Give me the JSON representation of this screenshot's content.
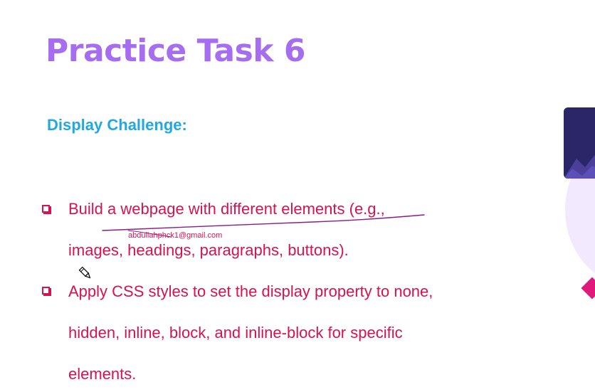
{
  "slide": {
    "title": "Practice Task 6",
    "subtitle": "Display Challenge:",
    "bullets": [
      {
        "lines": [
          "Build a webpage with different elements (e.g.,",
          "images, headings, paragraphs, buttons)."
        ]
      },
      {
        "lines": [
          "Apply CSS styles to set the display property to none,",
          "hidden, inline, block, and inline-block for specific",
          "elements."
        ]
      }
    ],
    "watermark": "abdullahphck1@gmail.com"
  },
  "colors": {
    "title": "#a66df0",
    "subtitle": "#22a8e1",
    "bullet_text": "#d4134f",
    "pen_annotation": "#8a1a8a",
    "deco_card": "#2b2766",
    "deco_circle": "#f3e9ff",
    "deco_diamond": "#e0197a"
  },
  "icons": {
    "bullet": "square-bullet-icon",
    "cursor": "pen-cursor-icon"
  }
}
